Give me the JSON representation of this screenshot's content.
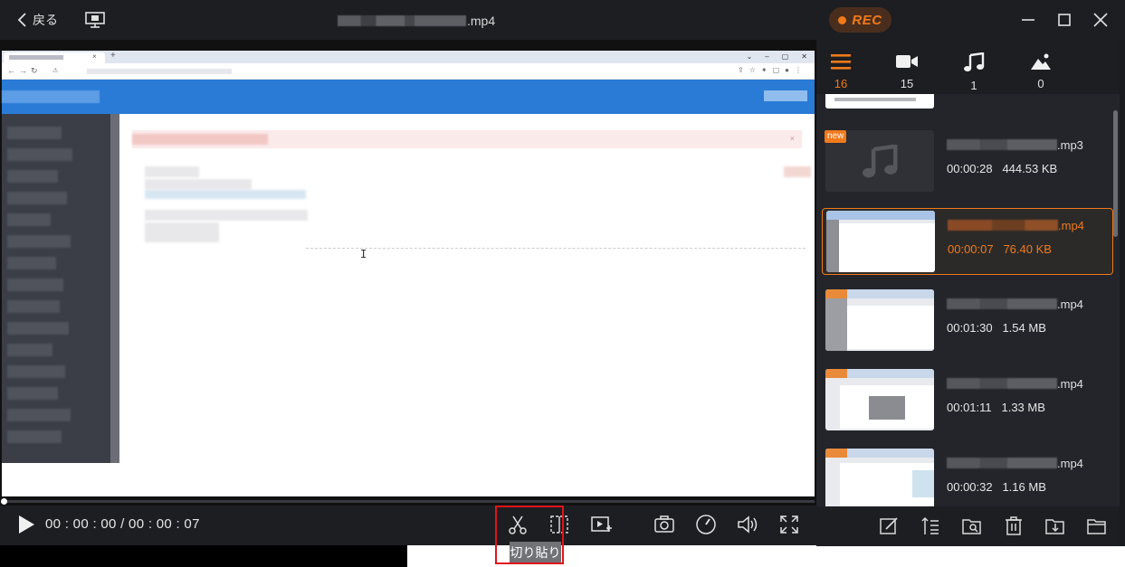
{
  "topbar": {
    "back_label": "戻る",
    "file_ext": ".mp4",
    "rec_label": "REC",
    "icons": [
      "chevron-left-icon",
      "monitor-icon",
      "minimize-icon",
      "maximize-icon",
      "close-icon"
    ]
  },
  "player": {
    "timecode": "00 : 00 : 00 / 00 : 00 : 07",
    "progress": 0.0,
    "tooltip": "切り貼り",
    "controls": [
      "play-icon",
      "scissors-icon",
      "crop-icon",
      "enhance-icon",
      "camera-icon",
      "speed-icon",
      "volume-icon",
      "fullscreen-icon"
    ]
  },
  "filters": [
    {
      "name": "all",
      "icon": "list-icon",
      "count": "16",
      "active": true
    },
    {
      "name": "video",
      "icon": "video-icon",
      "count": "15",
      "active": false
    },
    {
      "name": "audio",
      "icon": "music-icon",
      "count": "1",
      "active": false
    },
    {
      "name": "image",
      "icon": "image-icon",
      "count": "0",
      "active": false
    }
  ],
  "recordings": [
    {
      "ext": ".mp3",
      "duration": "00:00:28",
      "size": "444.53 KB",
      "badge": "new",
      "type": "audio",
      "selected": false
    },
    {
      "ext": ".mp4",
      "duration": "00:00:07",
      "size": "76.40 KB",
      "badge": "",
      "type": "video",
      "selected": true
    },
    {
      "ext": ".mp4",
      "duration": "00:01:30",
      "size": "1.54 MB",
      "badge": "",
      "type": "video",
      "selected": false
    },
    {
      "ext": ".mp4",
      "duration": "00:01:11",
      "size": "1.33 MB",
      "badge": "",
      "type": "video",
      "selected": false
    },
    {
      "ext": ".mp4",
      "duration": "00:00:32",
      "size": "1.16 MB",
      "badge": "",
      "type": "video",
      "selected": false
    }
  ],
  "panel_toolbar": [
    "edit-icon",
    "sort-icon",
    "search-folder-icon",
    "trash-icon",
    "export-icon",
    "folder-icon"
  ],
  "colors": {
    "accent": "#f07a1c",
    "bg": "#1d1e22",
    "panel": "#23252b",
    "highlight": "#e0141b"
  }
}
